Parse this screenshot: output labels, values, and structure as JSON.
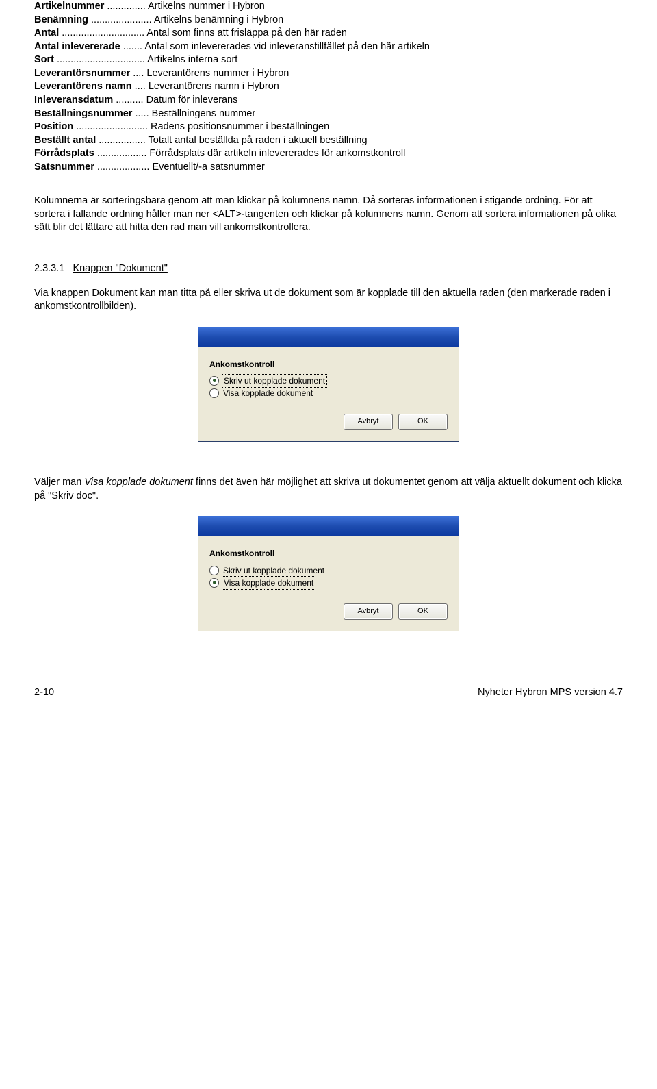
{
  "definitions": [
    {
      "label": "Artikelnummer",
      "dots": " .............. ",
      "value": "Artikelns nummer i Hybron"
    },
    {
      "label": "Benämning",
      "dots": " ...................... ",
      "value": "Artikelns benämning i Hybron"
    },
    {
      "label": "Antal",
      "dots": " .............................. ",
      "value": "Antal som finns att frisläppa på den här raden"
    },
    {
      "label": "Antal inlevererade",
      "dots": " ....... ",
      "value": "Antal som inlevererades vid inleveranstillfället på den här artikeln"
    },
    {
      "label": "Sort",
      "dots": " ................................ ",
      "value": "Artikelns interna sort"
    },
    {
      "label": "Leverantörsnummer",
      "dots": " .... ",
      "value": "Leverantörens nummer i Hybron"
    },
    {
      "label": "Leverantörens namn",
      "dots": " .... ",
      "value": "Leverantörens namn i Hybron"
    },
    {
      "label": "Inleveransdatum",
      "dots": " .......... ",
      "value": "Datum för inleverans"
    },
    {
      "label": "Beställningsnummer",
      "dots": " ..... ",
      "value": "Beställningens nummer"
    },
    {
      "label": "Position",
      "dots": " .......................... ",
      "value": "Radens positionsnummer i beställningen"
    },
    {
      "label": "Beställt antal",
      "dots": " ................. ",
      "value": "Totalt antal beställda på raden i aktuell beställning"
    },
    {
      "label": "Förrådsplats",
      "dots": " .................. ",
      "value": "Förrådsplats där artikeln inlevererades för ankomstkontroll"
    },
    {
      "label": "Satsnummer",
      "dots": " ................... ",
      "value": "Eventuellt/-a satsnummer"
    }
  ],
  "para_sorting": "Kolumnerna är sorteringsbara genom att man klickar på kolumnens namn. Då sorteras informationen i stigande ordning. För att sortera i fallande ordning håller man ner <ALT>-tangenten och klickar på kolumnens namn. Genom att sortera informationen på olika sätt blir det lättare att hitta den rad man vill ankomstkontrollera.",
  "section": {
    "number": "2.3.3.1",
    "title": "Knappen \"Dokument\""
  },
  "para_dokument": "Via knappen Dokument kan man titta på eller skriva ut de dokument som är kopplade till den aktuella raden (den markerade raden i ankomstkontrollbilden).",
  "dialog1": {
    "heading": "Ankomstkontroll",
    "opt1": "Skriv ut kopplade dokument",
    "opt2": "Visa kopplade dokument",
    "cancel": "Avbryt",
    "ok": "OK"
  },
  "para_visa": "Väljer man Visa kopplade dokument finns det även här möjlighet att skriva ut dokumentet genom att välja aktuellt dokument och klicka på \"Skriv doc\".",
  "dialog2": {
    "heading": "Ankomstkontroll",
    "opt1": "Skriv ut kopplade dokument",
    "opt2": "Visa kopplade dokument",
    "cancel": "Avbryt",
    "ok": "OK"
  },
  "footer": {
    "left": "2-10",
    "right": "Nyheter Hybron MPS version 4.7"
  }
}
